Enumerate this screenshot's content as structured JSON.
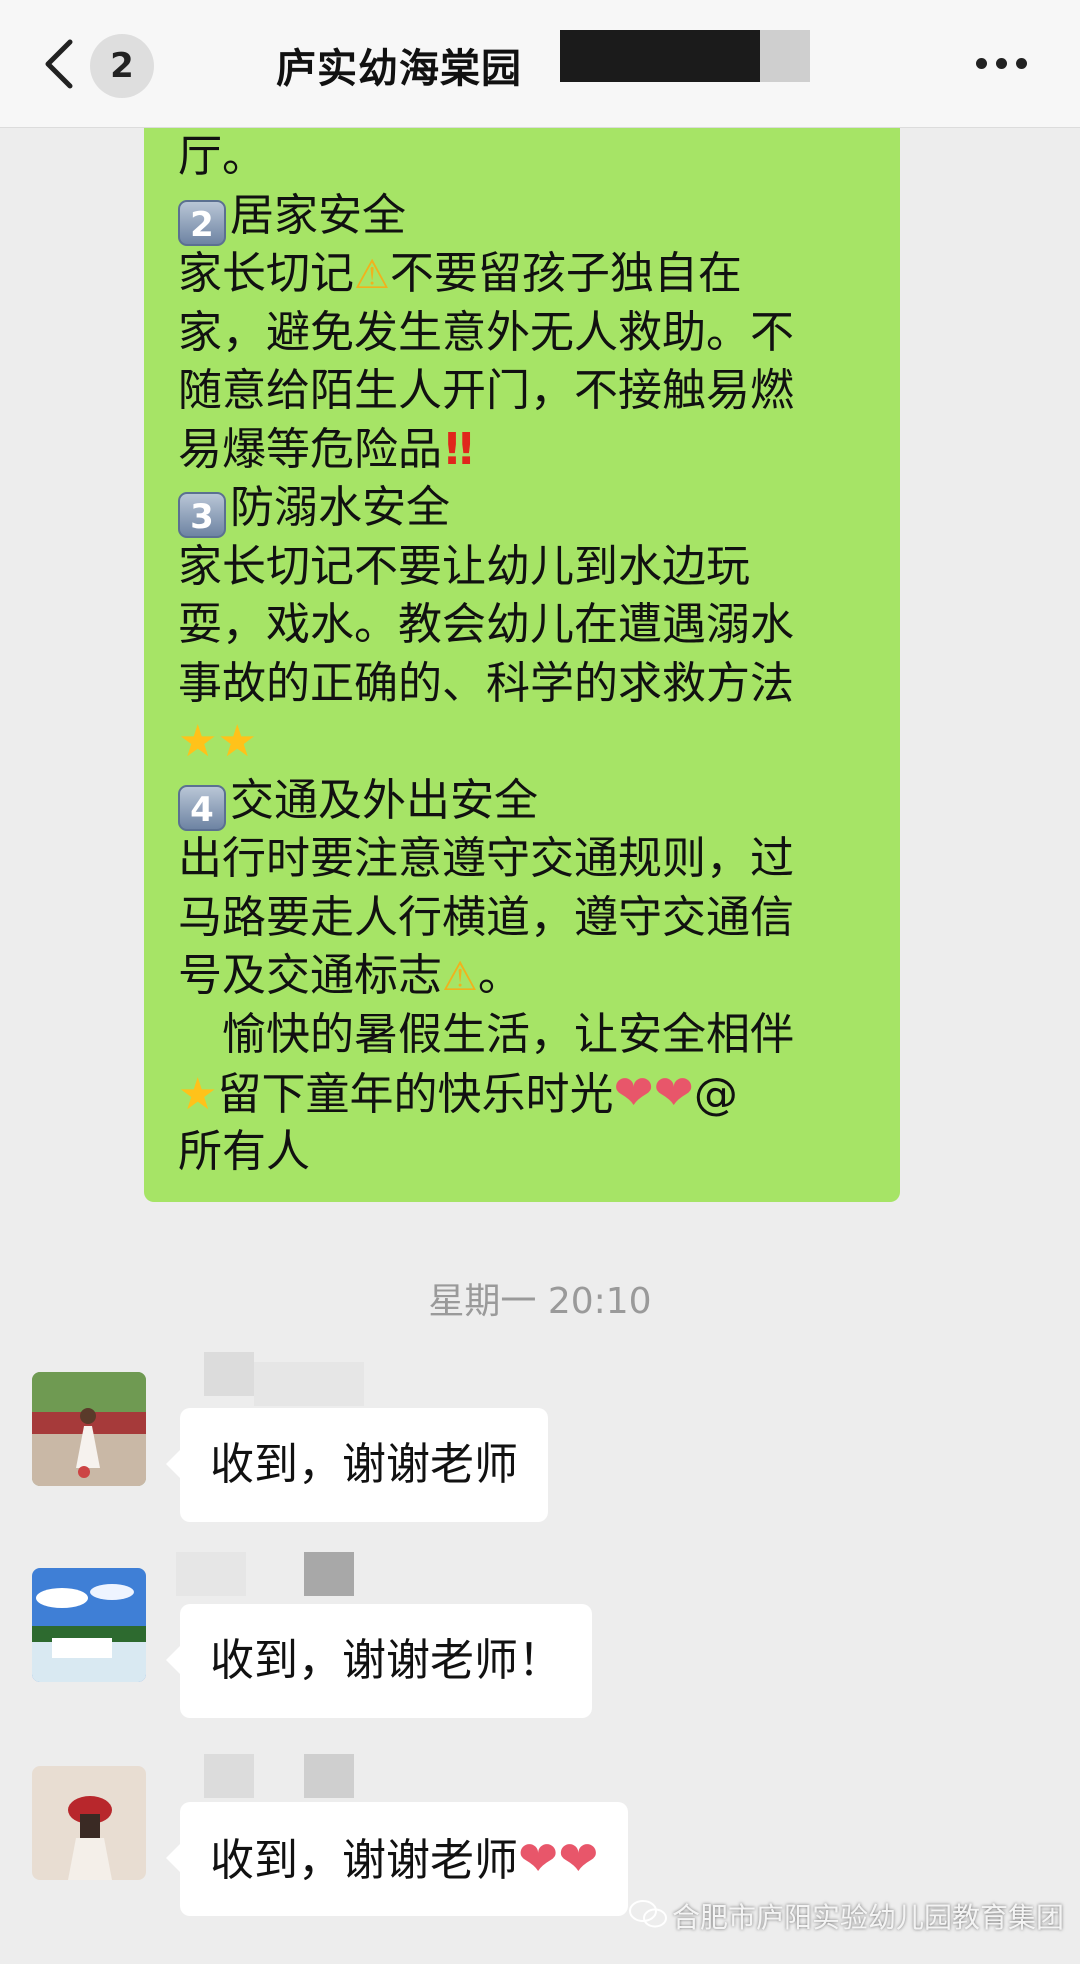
{
  "header": {
    "unread_count": "2",
    "title": "庐实幼海棠园"
  },
  "message": {
    "lines": [
      "厅。",
      "居家安全",
      "家长切记",
      "不要留孩子独自在",
      "家，避免发生意外无人救助。不",
      "随意给陌生人开门，不接触易燃",
      "易爆等危险品",
      "防溺水安全",
      "家长切记不要让幼儿到水边玩",
      "耍，戏水。教会幼儿在遭遇溺水",
      "事故的正确的、科学的求救方法",
      "交通及外出安全",
      "出行时要注意遵守交通规则，过",
      "马路要走人行横道，遵守交通信",
      "号及交通标志",
      "。",
      "愉快的暑假生活，让安全相伴",
      "留下童年的快乐时光",
      "@",
      "所有人"
    ],
    "keys": [
      "2",
      "3",
      "4"
    ],
    "emoji": {
      "warning": "⚠",
      "double_exclamation": "!!",
      "star": "★",
      "heart": "❤"
    }
  },
  "timestamp": "星期一 20:10",
  "replies": [
    {
      "text": "收到，谢谢老师",
      "avatar": "avatar-girl-white-dress"
    },
    {
      "text": "收到，谢谢老师！",
      "avatar": "avatar-waterfall"
    },
    {
      "text": "收到，谢谢老师",
      "avatar": "avatar-girl-red-hat"
    }
  ],
  "watermark": "合肥市庐阳实验幼儿园教育集团",
  "colors": {
    "sent_bubble": "#a6e466",
    "received_bubble": "#ffffff",
    "background": "#ededed"
  }
}
